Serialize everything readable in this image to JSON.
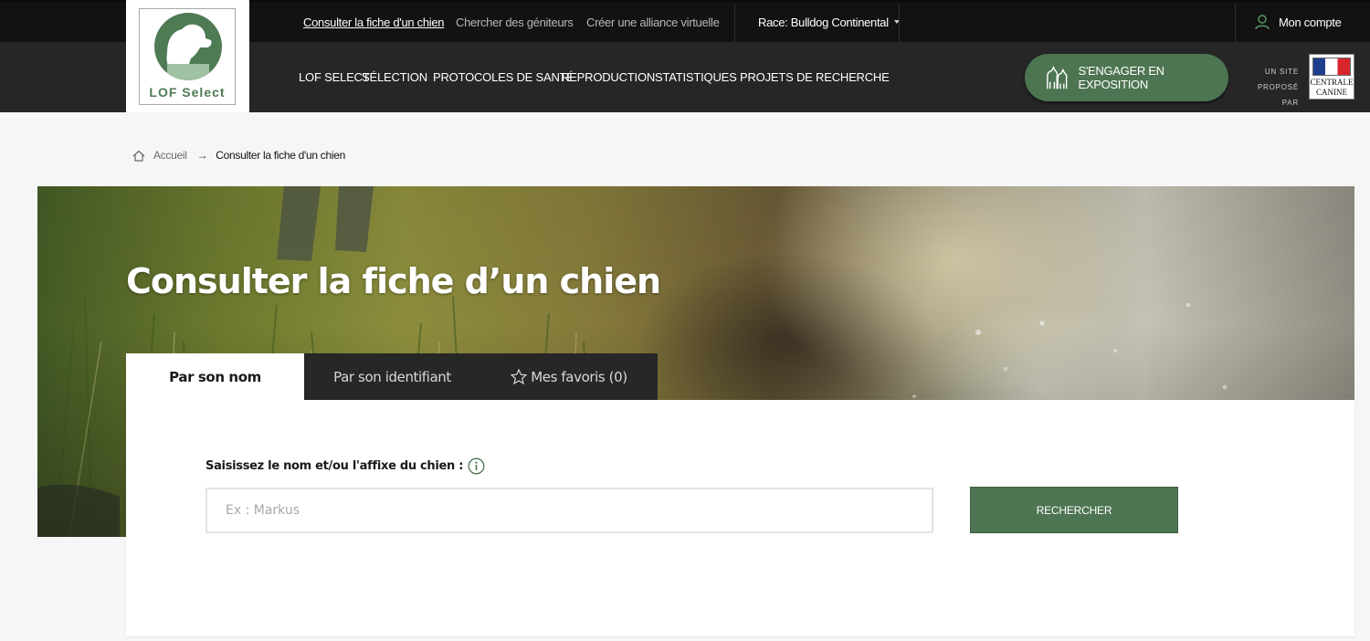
{
  "logo": {
    "name": "LOF Select",
    "icon": "dog-head-icon"
  },
  "topbar": {
    "items": [
      {
        "label": "Consulter la fiche d'un chien",
        "active": true
      },
      {
        "label": "Chercher des géniteurs",
        "active": false
      },
      {
        "label": "Créer une alliance virtuelle",
        "active": false
      }
    ],
    "race_label": "Race: Bulldog Continental",
    "account_label": "Mon compte"
  },
  "mainnav": {
    "items": [
      "LOF SELECT",
      "SÉLECTION",
      "PROTOCOLES DE SANTÉ",
      "REPRODUCTION",
      "STATISTIQUES",
      "PROJETS DE RECHERCHE"
    ],
    "engage_label": "S'ENGAGER EN EXPOSITION",
    "proposed_line1": "UN SITE",
    "proposed_line2": "PROPOSÉ PAR",
    "partner_line1": "CENTRALE",
    "partner_line2": "CANINE"
  },
  "breadcrumb": {
    "home": "Accueil",
    "current": "Consulter la fiche d'un chien"
  },
  "hero": {
    "title": "Consulter la fiche d’un chien"
  },
  "tabs": [
    {
      "label": "Par son nom",
      "active": true
    },
    {
      "label": "Par son identifiant",
      "active": false
    },
    {
      "label": "Mes favoris (0)",
      "active": false
    }
  ],
  "search": {
    "label": "Saisissez le nom et/ou l'affixe du chien :",
    "value": "",
    "placeholder": "Ex : Markus",
    "button_label": "RECHERCHER"
  },
  "colors": {
    "accent_green": "#4d7551",
    "dark_bar": "#121212",
    "nav_bar": "#262626"
  }
}
